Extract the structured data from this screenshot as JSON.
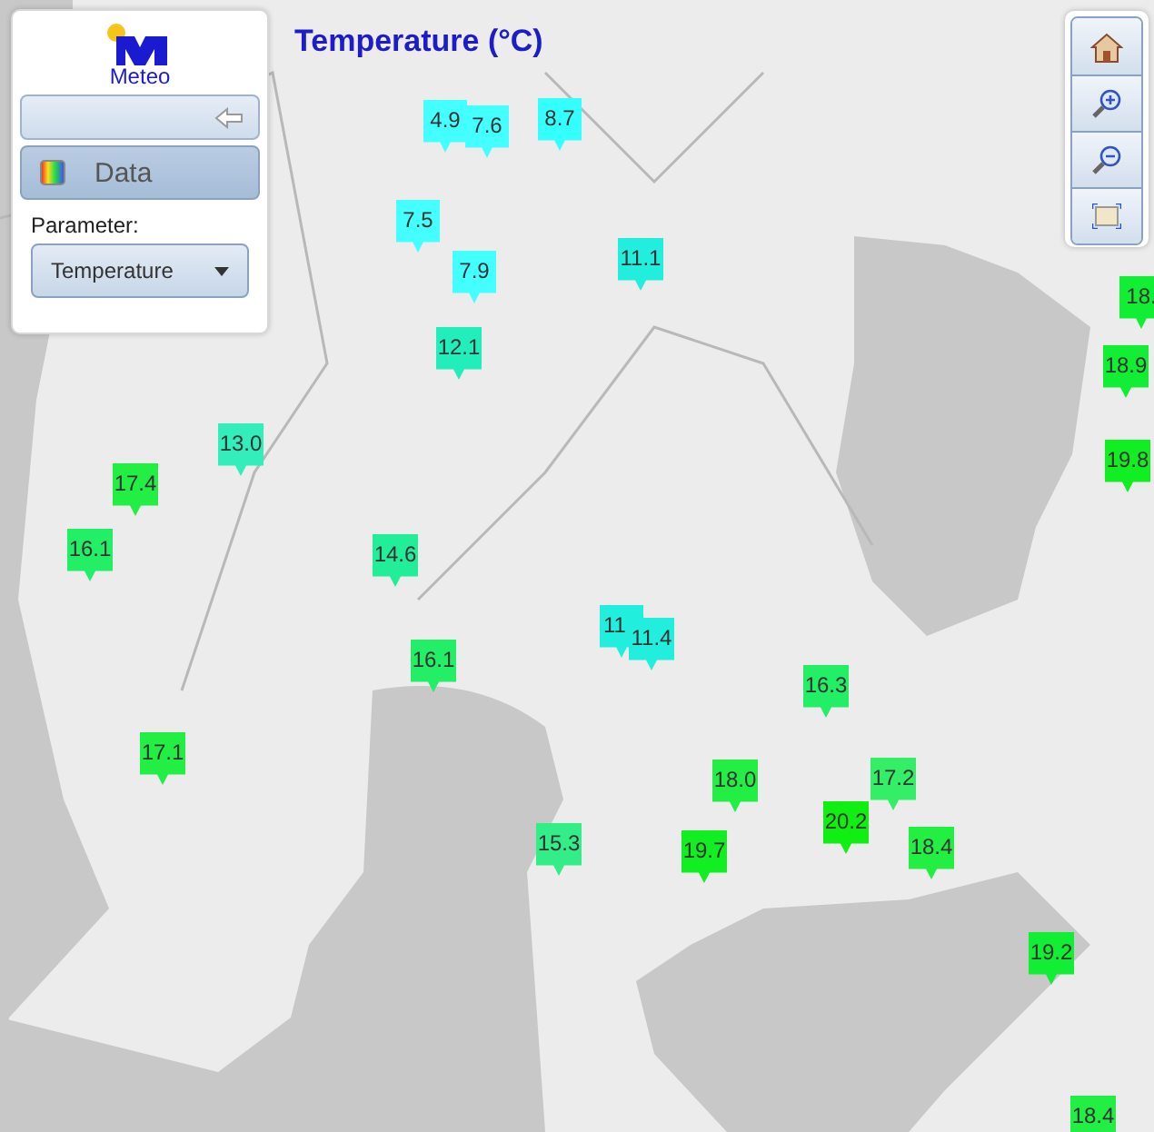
{
  "title": "Temperature (°C)",
  "panel": {
    "logo_text": "Meteo",
    "section": "Data",
    "parameter_label": "Parameter:",
    "parameter_value": "Temperature"
  },
  "markers": [
    {
      "value": "4.9",
      "color": "#44ffff"
    },
    {
      "value": "7.6",
      "color": "#44ffff"
    },
    {
      "value": "8.7",
      "color": "#33ffff"
    },
    {
      "value": "7.5",
      "color": "#44ffff"
    },
    {
      "value": "7.9",
      "color": "#44ffff"
    },
    {
      "value": "11.1",
      "color": "#22eedd"
    },
    {
      "value": "12.1",
      "color": "#22eebb"
    },
    {
      "value": "13.0",
      "color": "#33eebb"
    },
    {
      "value": "17.4",
      "color": "#22ee44"
    },
    {
      "value": "16.1",
      "color": "#22ee66"
    },
    {
      "value": "14.6",
      "color": "#22ee99"
    },
    {
      "value": "16.1",
      "color": "#22ee66"
    },
    {
      "value": "17.1",
      "color": "#22ee44"
    },
    {
      "value": "15.3",
      "color": "#33ee88"
    },
    {
      "value": "11",
      "color": "#22eedd"
    },
    {
      "value": "11.4",
      "color": "#22eedd"
    },
    {
      "value": "16.3",
      "color": "#22ee66"
    },
    {
      "value": "18.0",
      "color": "#22ee44"
    },
    {
      "value": "17.2",
      "color": "#33ee66"
    },
    {
      "value": "20.2",
      "color": "#11ee11"
    },
    {
      "value": "19.7",
      "color": "#11ee22"
    },
    {
      "value": "18.4",
      "color": "#22ee44"
    },
    {
      "value": "19.2",
      "color": "#11ee33"
    },
    {
      "value": "18.4",
      "color": "#22ee44"
    },
    {
      "value": "18.",
      "color": "#11ee33"
    },
    {
      "value": "18.9",
      "color": "#11ee33"
    },
    {
      "value": "19.8",
      "color": "#11ee22"
    }
  ],
  "zoom_controls": [
    {
      "kind": "home"
    },
    {
      "kind": "zoom-in"
    },
    {
      "kind": "zoom-out"
    },
    {
      "kind": "extent"
    }
  ]
}
